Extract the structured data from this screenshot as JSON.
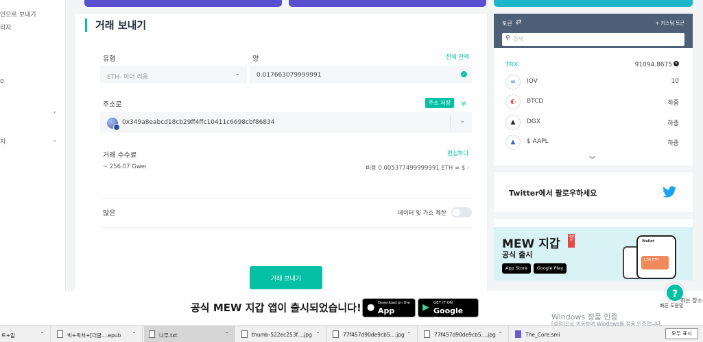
{
  "sidebar": {
    "items": [
      {
        "label": "인으로 보내기",
        "top": 0
      },
      {
        "label": "리자",
        "top": 0
      },
      {
        "label": "o",
        "top": 0
      },
      {
        "label": "지",
        "top": 0
      }
    ]
  },
  "send": {
    "title": "거래 보내기",
    "type_label": "유형",
    "type_value": "ETH- 이더 리움",
    "amount_label": "양",
    "entire_balance": "전체 잔액",
    "amount_value": "0.017663079999991",
    "address_label": "주소로",
    "save_address": "주소 저장",
    "address_extra": "부",
    "address_value": "0x349a8eabcd18cb29ff4ffc10411c6698cbf86834",
    "fee_label": "거래 수수료",
    "edit": "편집하다",
    "gwei": "~ 256.07 Gwei",
    "cost": "비용 0.005377499999991 ETH = $ -",
    "advanced_label": "많은",
    "data_gas_label": "데이터 및 가스 제한",
    "send_button": "거래 보내기"
  },
  "tokens": {
    "title": "토큰",
    "custom": "+ 커스텀 토큰",
    "search_placeholder": "검색",
    "trx": {
      "name": "TRX",
      "value": "91094.8675"
    },
    "items": [
      {
        "name": "IOV",
        "value": "10"
      },
      {
        "name": "BTCD",
        "value": "하중"
      },
      {
        "name": "DGX",
        "value": "하중"
      },
      {
        "name": "$ AAPL",
        "value": "하중"
      }
    ]
  },
  "twitter": {
    "text": "Twitter에서 팔로우하세요"
  },
  "promo": {
    "title": "MEW 지갑",
    "badge": "새로운",
    "subtitle": "공식 출시",
    "app_store": "App Store",
    "google_play": "Google Play",
    "phone_title": "Wallet",
    "phone_balance": "1.56 ETH"
  },
  "banner": {
    "message": "공식 MEW 지갑 앱이 출시되었습니다!",
    "app_store_small": "Download on the",
    "app_store": "App Store",
    "google_small": "GET IT ON",
    "google_play": "Google Play"
  },
  "help": {
    "label": "빠른 도움말",
    "overlay": "하는 장소"
  },
  "windows": {
    "line1": "Windows 정품 인증",
    "line2": "[설정]으로 이동하여 Windows를 정품 인증합니다."
  },
  "taskbar": {
    "items": [
      "트+앎",
      "빅+픽처+[더글....epub",
      "나무.txt",
      "thumb-522ec253f....jpg",
      "77f457d90de9cb5....jpg",
      "77f457d90de9cb5....jpg",
      "The_Core.smi"
    ],
    "show_all": "모두 표시"
  },
  "colors": {
    "accent": "#05c0a5",
    "token_header": "#4e6078",
    "twitter": "#1da1f2"
  }
}
